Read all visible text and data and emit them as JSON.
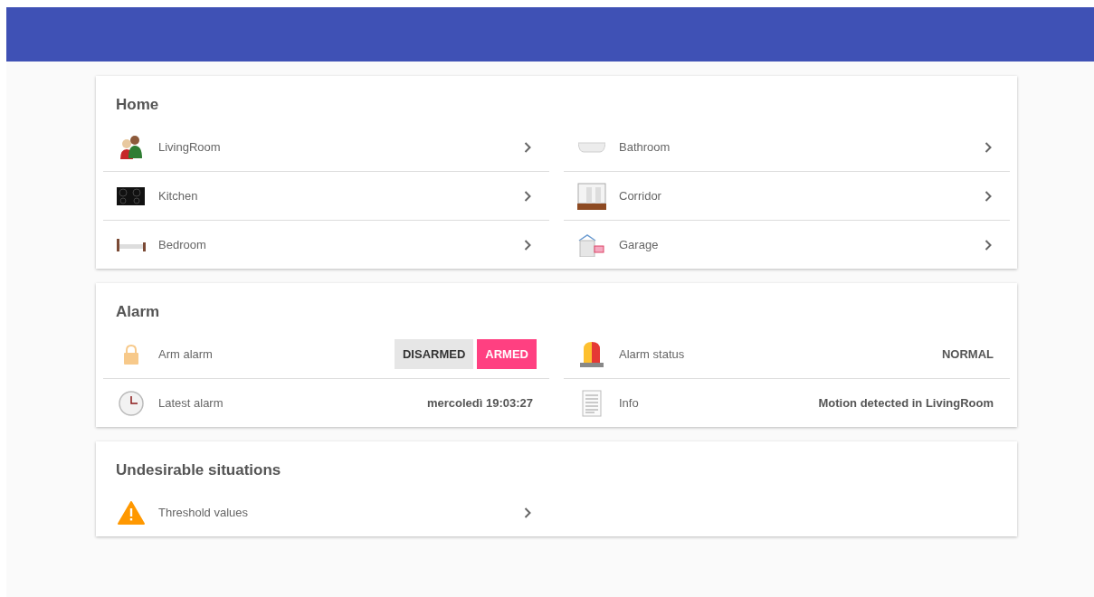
{
  "home": {
    "title": "Home",
    "rooms": [
      {
        "label": "LivingRoom"
      },
      {
        "label": "Bathroom"
      },
      {
        "label": "Kitchen"
      },
      {
        "label": "Corridor"
      },
      {
        "label": "Bedroom"
      },
      {
        "label": "Garage"
      }
    ]
  },
  "alarm": {
    "title": "Alarm",
    "rows": [
      {
        "kind": "toggle",
        "label": "Arm alarm",
        "options": [
          {
            "label": "DISARMED",
            "selected": false
          },
          {
            "label": "ARMED",
            "selected": true
          }
        ]
      },
      {
        "kind": "value",
        "label": "Alarm status",
        "value": "NORMAL"
      },
      {
        "kind": "value",
        "label": "Latest alarm",
        "value": "mercoledì 19:03:27"
      },
      {
        "kind": "value",
        "label": "Info",
        "value": "Motion detected in LivingRoom"
      }
    ]
  },
  "undesirable": {
    "title": "Undesirable situations",
    "items": [
      {
        "label": "Threshold values"
      }
    ]
  }
}
